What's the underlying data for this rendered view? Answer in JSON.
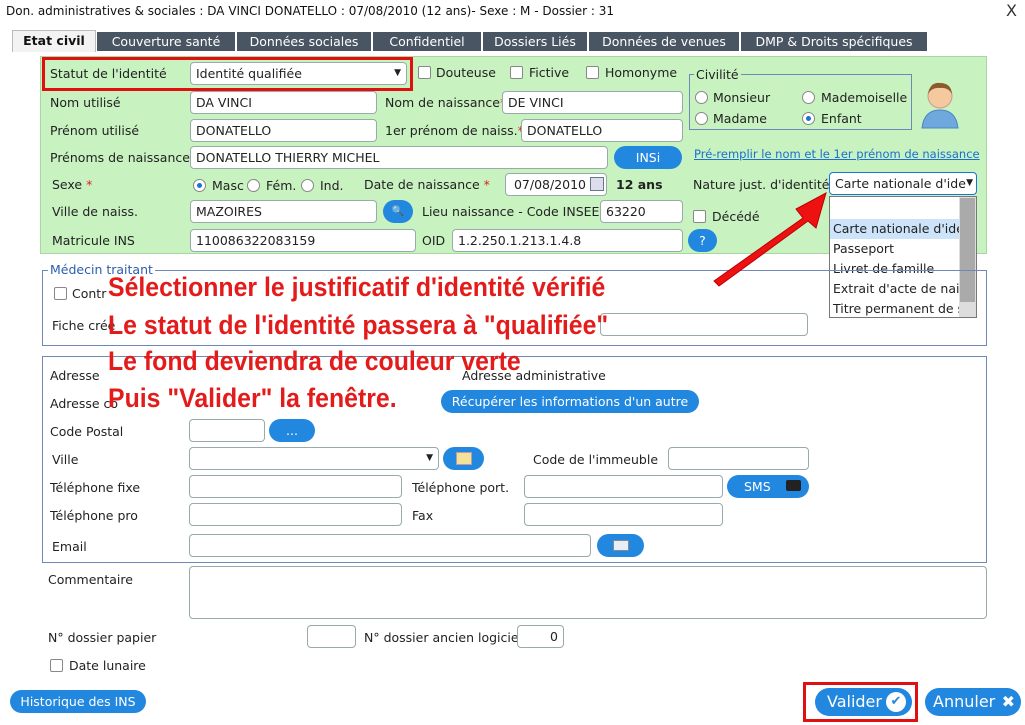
{
  "window": {
    "title": "Don. administratives & sociales : DA VINCI DONATELLO : 07/08/2010 (12 ans)- Sexe : M - Dossier : 31",
    "close": "X"
  },
  "tabs": [
    "Etat civil",
    "Couverture santé",
    "Données sociales",
    "Confidentiel",
    "Dossiers Liés",
    "Données de venues",
    "DMP & Droits spécifiques"
  ],
  "identity": {
    "statut_label": "Statut de l'identité",
    "statut_value": "Identité qualifiée",
    "douteuse": "Douteuse",
    "fictive": "Fictive",
    "homonyme": "Homonyme",
    "civilite_legend": "Civilité",
    "monsieur": "Monsieur",
    "mademoiselle": "Mademoiselle",
    "madame": "Madame",
    "enfant": "Enfant",
    "nom_utilise_label": "Nom utilisé",
    "nom_utilise": "DA VINCI",
    "nom_naissance_label": "Nom de naissance",
    "nom_naissance": "DE VINCI",
    "prenom_utilise_label": "Prénom utilisé",
    "prenom_utilise": "DONATELLO",
    "premier_prenom_label": "1er prénom de naiss.",
    "premier_prenom": "DONATELLO",
    "prenoms_naissance_label": "Prénoms de naissance",
    "prenoms_naissance": "DONATELLO THIERRY MICHEL",
    "insi_button": "INSi",
    "prefill_link": "Pré-remplir le nom et le 1er prénom de naissance",
    "sexe_label": "Sexe",
    "masc": "Masc",
    "fem": "Fém.",
    "ind": "Ind.",
    "date_naissance_label": "Date de naissance",
    "date_naissance": "07/08/2010",
    "age": "12 ans",
    "nature_label": "Nature just. d'identité",
    "nature_value": "Carte nationale d'iden",
    "ville_label": "Ville de naiss.",
    "ville": "MAZOIRES",
    "lieu_label": "Lieu naissance - Code INSEE",
    "lieu": "63220",
    "decede": "Décédé",
    "matricule_label": "Matricule INS",
    "matricule": "110086322083159",
    "oid_label": "OID",
    "oid": "1.2.250.1.213.1.4.8",
    "help": "?"
  },
  "dropdown_options": [
    "Carte nationale d'iden",
    "Passeport",
    "Livret de famille",
    "Extrait d'acte de naiss",
    "Titre permanent de sé"
  ],
  "medecin": {
    "legend": "Médecin traitant",
    "contr": "Contr",
    "fiche": "Fiche créé"
  },
  "address": {
    "adresse_label": "Adresse",
    "adresse_admin": "Adresse administrative",
    "adresse_c": "Adresse co",
    "recuperer_button": "Récupérer les informations d'un autre",
    "code_postal_label": "Code Postal",
    "dots_button": "...",
    "ville_label": "Ville",
    "code_immeuble_label": "Code de l'immeuble",
    "tel_fixe_label": "Téléphone fixe",
    "tel_port_label": "Téléphone port.",
    "sms_button": "SMS",
    "tel_pro_label": "Téléphone pro",
    "fax_label": "Fax",
    "email_label": "Email"
  },
  "commentaire_label": "Commentaire",
  "dossier_papier_label": "N° dossier papier",
  "dossier_ancien_label": "N° dossier ancien logiciel",
  "dossier_ancien_value": "0",
  "date_lunaire": "Date lunaire",
  "historique_button": "Historique des INS",
  "valider_button": "Valider",
  "annuler_button": "Annuler",
  "annotation": [
    "Sélectionner le justificatif d'identité vérifié",
    "Le statut de l'identité passera à \"qualifiée\"",
    "Le fond deviendra de couleur verte",
    "Puis \"Valider\" la fenêtre."
  ],
  "colors": {
    "accent": "#2287df",
    "highlight": "#e01010",
    "identity_bg": "#c9f2c1",
    "tab_bg": "#4a5563"
  }
}
